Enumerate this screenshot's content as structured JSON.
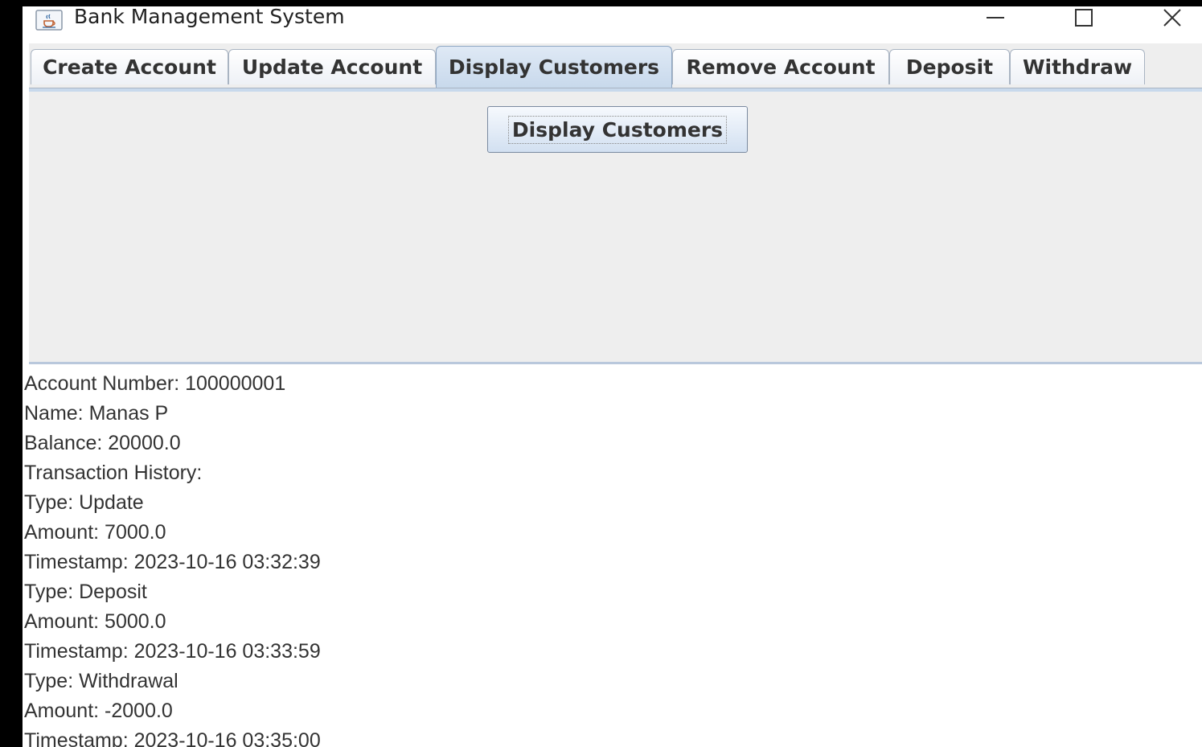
{
  "window": {
    "title": "Bank Management System",
    "icons": {
      "app": "java-cup-icon",
      "minimize": "minimize-icon",
      "maximize": "maximize-icon",
      "close": "close-icon"
    }
  },
  "tabs": [
    {
      "label": "Create Account",
      "selected": false
    },
    {
      "label": "Update Account",
      "selected": false
    },
    {
      "label": "Display Customers",
      "selected": true
    },
    {
      "label": "Remove Account",
      "selected": false
    },
    {
      "label": "Deposit",
      "selected": false
    },
    {
      "label": "Withdraw",
      "selected": false
    }
  ],
  "panel": {
    "display_button_label": "Display Customers"
  },
  "output": {
    "lines": [
      "Account Number: 100000001",
      "Name: Manas P",
      "Balance: 20000.0",
      "Transaction History:",
      "Type: Update",
      "Amount: 7000.0",
      "Timestamp: 2023-10-16 03:32:39",
      "Type: Deposit",
      "Amount: 5000.0",
      "Timestamp: 2023-10-16 03:33:59",
      "Type: Withdrawal",
      "Amount: -2000.0",
      "Timestamp: 2023-10-16 03:35:00"
    ]
  },
  "colors": {
    "tab_selected": "#c8d9ec",
    "panel_bg": "#eeeeee",
    "text": "#333333"
  }
}
